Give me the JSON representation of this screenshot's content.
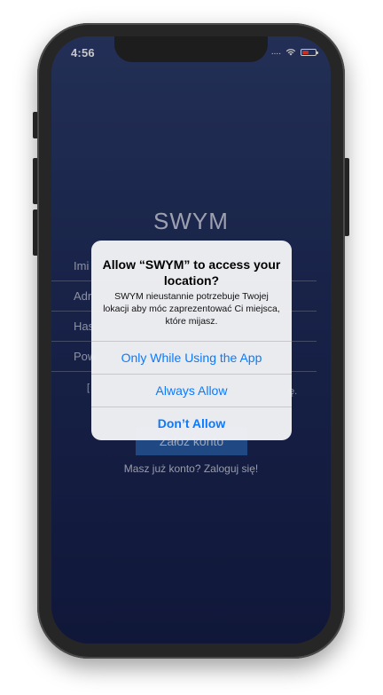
{
  "status_bar": {
    "time": "4:56",
    "signal": "....",
    "wifi_icon": "wifi-icon",
    "battery_icon": "battery-icon"
  },
  "app": {
    "title": "SWYM",
    "fields": [
      "Imi",
      "Adr",
      "Has",
      "Pow"
    ],
    "terms_start": "[",
    "terms_end": "ę.",
    "register_button": "Załóż konto",
    "login_link": "Masz już konto? Zaloguj się!"
  },
  "alert": {
    "title": "Allow “SWYM” to access your location?",
    "message": "SWYM nieustannie potrzebuje Twojej lokacji aby móc zaprezentować Ci miejsca, które mijasz.",
    "buttons": {
      "while_using": "Only While Using the App",
      "always": "Always Allow",
      "dont_allow": "Don’t Allow"
    }
  },
  "colors": {
    "accent": "#0a7aff",
    "background_top": "#2d3d6e",
    "background_bottom": "#151e4a"
  }
}
